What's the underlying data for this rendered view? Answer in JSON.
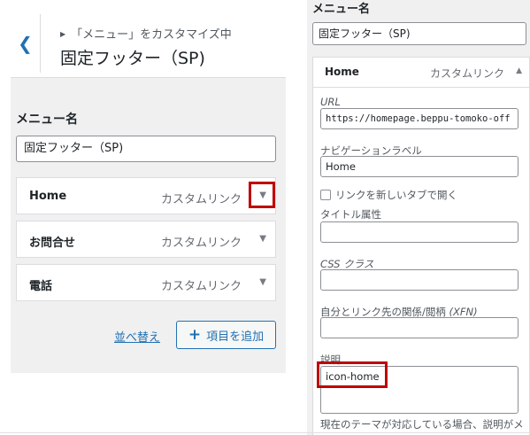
{
  "left": {
    "breadcrumb": "「メニュー」をカスタマイズ中",
    "title": "固定フッター（SP)",
    "menu_name_label": "メニュー名",
    "menu_name_value": "固定フッター（SP)",
    "items": [
      {
        "title": "Home",
        "type": "カスタムリンク"
      },
      {
        "title": "お問合せ",
        "type": "カスタムリンク"
      },
      {
        "title": "電話",
        "type": "カスタムリンク"
      }
    ],
    "reorder_label": "並べ替え",
    "add_items_label": "項目を追加",
    "highlight_color": "#c00000"
  },
  "right": {
    "menu_name_label": "メニュー名",
    "menu_name_value": "固定フッター（SP)",
    "item_title": "Home",
    "item_type": "カスタムリンク",
    "url_label": "URL",
    "url_value": "https://homepage.beppu-tomoko-off",
    "nav_label": "ナビゲーションラベル",
    "nav_value": "Home",
    "newtab_label": "リンクを新しいタブで開く",
    "title_attr_label": "タイトル属性",
    "title_attr_value": "",
    "css_label": "CSS クラス",
    "css_value": "",
    "xfn_label_main": "自分とリンク先の関係/閲柄",
    "xfn_label_abbr": "(XFN)",
    "xfn_value": "",
    "desc_label": "説明",
    "desc_value": "icon-home",
    "desc_help": "現在のテーマが対応している場合、説明がメ"
  }
}
